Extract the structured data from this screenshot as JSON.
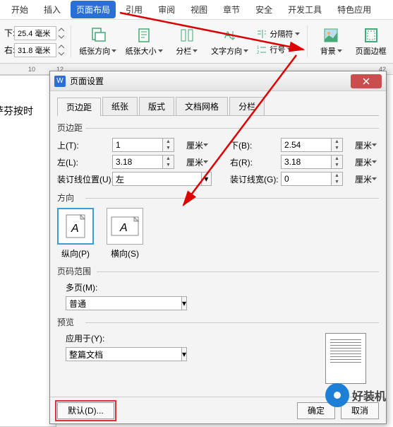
{
  "ribbon": {
    "tabs": [
      "开始",
      "插入",
      "页面布局",
      "引用",
      "审阅",
      "视图",
      "章节",
      "安全",
      "开发工具",
      "特色应用"
    ],
    "active_tab": "页面布局",
    "margin_top_label": "下:",
    "margin_top_value": "25.4 毫米",
    "margin_bottom_label": "右:",
    "margin_bottom_value": "31.8 毫米",
    "orientation_label": "纸张方向",
    "size_label": "纸张大小",
    "columns_label": "分栏",
    "text_direction_label": "文字方向",
    "break_label": "分隔符",
    "line_numbers_label": "行号",
    "background_label": "背景",
    "page_border_label": "页面边框"
  },
  "ruler": [
    "10",
    "12",
    "42"
  ],
  "doc_sample": "萨芬按时",
  "dialog": {
    "title": "页面设置",
    "tabs": [
      "页边距",
      "纸张",
      "版式",
      "文档网格",
      "分栏"
    ],
    "active_tab": "页边距",
    "section_margins": "页边距",
    "top_label": "上(T):",
    "top_value": "1",
    "top_unit": "厘米",
    "bottom_label": "下(B):",
    "bottom_value": "2.54",
    "bottom_unit": "厘米",
    "left_label": "左(L):",
    "left_value": "3.18",
    "left_unit": "厘米",
    "right_label": "右(R):",
    "right_value": "3.18",
    "right_unit": "厘米",
    "gutter_pos_label": "装订线位置(U):",
    "gutter_pos_value": "左",
    "gutter_width_label": "装订线宽(G):",
    "gutter_width_value": "0",
    "gutter_width_unit": "厘米",
    "section_orientation": "方向",
    "portrait_label": "纵向(P)",
    "landscape_label": "横向(S)",
    "section_pages": "页码范围",
    "multipage_label": "多页(M):",
    "multipage_value": "普通",
    "section_preview": "预览",
    "apply_label": "应用于(Y):",
    "apply_value": "整篇文档",
    "default_btn": "默认(D)...",
    "ok_btn": "确定",
    "cancel_btn": "取消"
  },
  "watermark": "好装机"
}
